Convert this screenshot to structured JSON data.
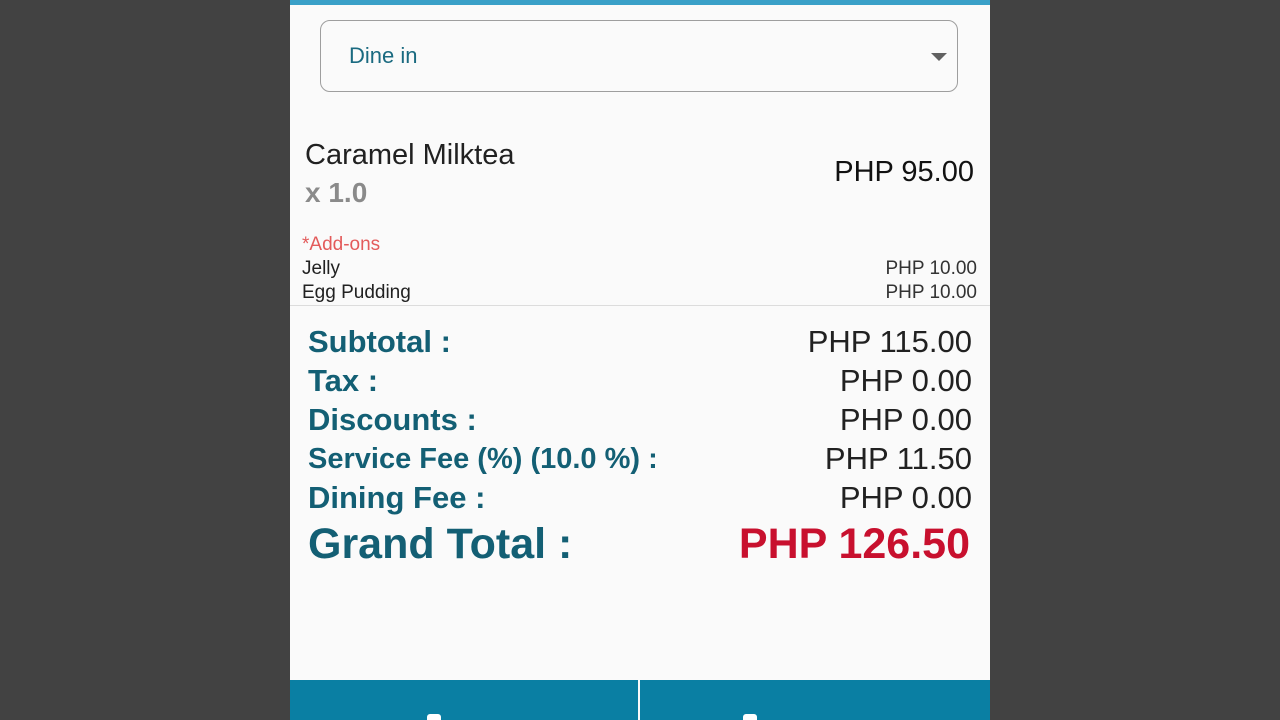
{
  "order_type": {
    "selected": "Dine in"
  },
  "item": {
    "name": "Caramel Milktea",
    "quantity": "x 1.0",
    "price": "PHP 95.00"
  },
  "addons": {
    "label": "*Add-ons",
    "items": [
      {
        "name": "Jelly",
        "price": "PHP 10.00"
      },
      {
        "name": "Egg Pudding",
        "price": "PHP 10.00"
      }
    ]
  },
  "summary": {
    "subtotal": {
      "label": "Subtotal :",
      "value": "PHP 115.00"
    },
    "tax": {
      "label": "Tax :",
      "value": "PHP 0.00"
    },
    "discounts": {
      "label": "Discounts :",
      "value": "PHP 0.00"
    },
    "service_fee": {
      "label": "Service Fee (%) (10.0 %) :",
      "value": "PHP 11.50"
    },
    "dining_fee": {
      "label": "Dining Fee :",
      "value": "PHP 0.00"
    },
    "grand_total": {
      "label": "Grand Total :",
      "value": "PHP 126.50"
    }
  },
  "colors": {
    "accent": "#0a7fa3",
    "topbar": "#3aa0c8",
    "label": "#135f74",
    "grand_total": "#c8102e",
    "addons_label": "#e35b5b"
  },
  "icons": {
    "dropdown": "chevron-down-icon",
    "bottom_left": "button-icon",
    "bottom_right": "button-icon"
  }
}
